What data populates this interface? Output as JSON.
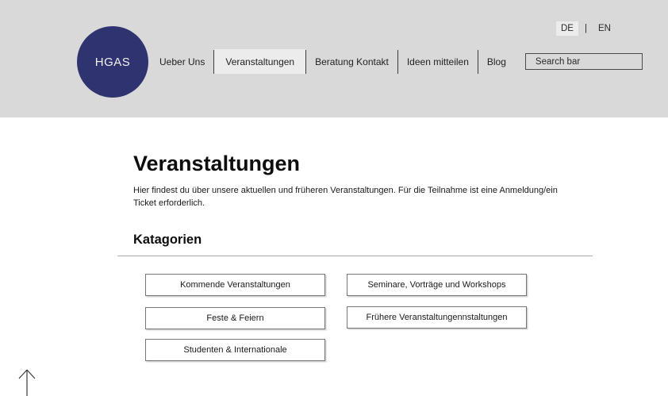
{
  "header": {
    "logo_text": "HGAS",
    "nav": [
      {
        "label": "Ueber Uns"
      },
      {
        "label": "Veranstaltungen"
      },
      {
        "label": "Beratung Kontakt"
      },
      {
        "label": "Ideen mitteilen"
      },
      {
        "label": "Blog"
      }
    ],
    "active_nav": "Veranstaltungen",
    "search_placeholder": "Search bar",
    "language": {
      "de_label": "DE",
      "divider": "|",
      "en_label": "EN",
      "active": "DE"
    }
  },
  "main": {
    "title": "Veranstaltungen",
    "description": "Hier findest du über unsere aktuellen und früheren Veranstaltungen. Für die Teilnahme ist eine Anmeldung/ein Ticket erforderlich.",
    "categories_heading": "Katagorien",
    "category_buttons": [
      "Kommende Veranstaltungen",
      "Seminare, Vorträge und Workshops",
      "Feste & Feiern",
      "Frühere Veranstaltungennstaltungen",
      "Studenten & Internationale"
    ]
  },
  "colors": {
    "header_bg": "#d9d9d9",
    "logo_bg": "#2f336f",
    "active_item_bg": "#ececec",
    "page_bg": "#ffffff",
    "button_border": "#767676"
  }
}
